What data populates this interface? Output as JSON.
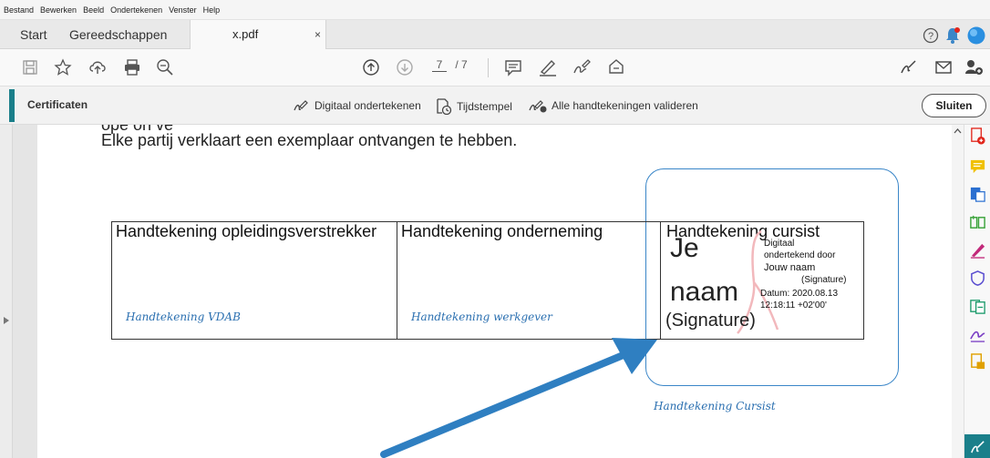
{
  "menu": [
    "Bestand",
    "Bewerken",
    "Beeld",
    "Ondertekenen",
    "Venster",
    "Help"
  ],
  "tabs": {
    "start": "Start",
    "tools": "Gereedschappen",
    "file": "x.pdf",
    "close": "×"
  },
  "toolbar": {
    "page_current": "7",
    "page_total": "/ 7"
  },
  "certificates": {
    "title": "Certificaten",
    "digital_sign": "Digitaal ondertekenen",
    "timestamp": "Tijdstempel",
    "validate": "Alle handtekeningen valideren",
    "close": "Sluiten"
  },
  "document": {
    "partial_line": "ope on ve",
    "line": "Elke partij verklaart een exemplaar ontvangen te hebben.",
    "columns": [
      "Handtekening opleidingsverstrekker",
      "Handtekening onderneming",
      "Handtekening cursist"
    ],
    "field1": "Handtekening VDAB",
    "field2": "Handtekening werkgever",
    "signature": {
      "big1": "Je",
      "big2": "naam",
      "big3": "(Signature)",
      "l1": "Digitaal",
      "l2": "ondertekend door",
      "l3": "Jouw naam",
      "l4": "(Signature)",
      "l5": "Datum: 2020.08.13",
      "l6": "12:18:11 +02'00'"
    },
    "annotation": "Handtekening Cursist"
  },
  "colors": {
    "accent": "#1a7f8a",
    "annotation_blue": "#3a86c8"
  }
}
